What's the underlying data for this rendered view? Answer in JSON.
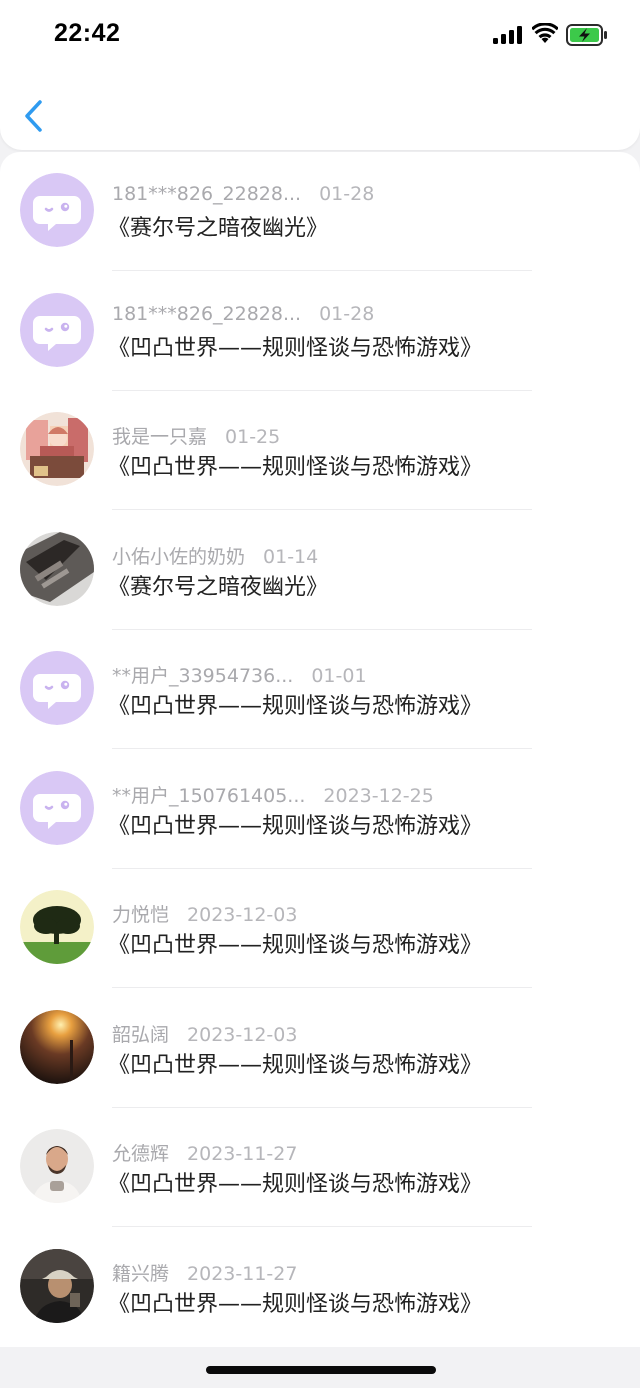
{
  "status_bar": {
    "time": "22:42",
    "icons": [
      "cellular-signal-icon",
      "wifi-icon",
      "battery-charging-icon"
    ],
    "battery_color": "#3cc94a"
  },
  "nav": {
    "back_icon": "chevron-left-icon",
    "accent_color": "#2f9bf0"
  },
  "list": {
    "items": [
      {
        "name": "181***826_22828...",
        "date": "01-28",
        "title": "《赛尔号之暗夜幽光》",
        "avatar": "default-chat-bubble-avatar"
      },
      {
        "name": "181***826_22828...",
        "date": "01-28",
        "title": "《凹凸世界——规则怪谈与恐怖游戏》",
        "avatar": "default-chat-bubble-avatar"
      },
      {
        "name": "我是一只嘉",
        "date": "01-25",
        "title": "《凹凸世界——规则怪谈与恐怖游戏》",
        "avatar": "anime-illustration-avatar"
      },
      {
        "name": "小佑小佐的奶奶",
        "date": "01-14",
        "title": "《赛尔号之暗夜幽光》",
        "avatar": "photo-avatar"
      },
      {
        "name": "**用户_33954736...",
        "date": "01-01",
        "title": "《凹凸世界——规则怪谈与恐怖游戏》",
        "avatar": "default-chat-bubble-avatar"
      },
      {
        "name": "**用户_150761405...",
        "date": "2023-12-25",
        "title": "《凹凸世界——规则怪谈与恐怖游戏》",
        "avatar": "default-chat-bubble-avatar"
      },
      {
        "name": "力悦恺",
        "date": "2023-12-03",
        "title": "《凹凸世界——规则怪谈与恐怖游戏》",
        "avatar": "tree-landscape-avatar"
      },
      {
        "name": "韶弘阔",
        "date": "2023-12-03",
        "title": "《凹凸世界——规则怪谈与恐怖游戏》",
        "avatar": "sunset-photo-avatar"
      },
      {
        "name": "允德辉",
        "date": "2023-11-27",
        "title": "《凹凸世界——规则怪谈与恐怖游戏》",
        "avatar": "person-photo-avatar"
      },
      {
        "name": "籍兴腾",
        "date": "2023-11-27",
        "title": "《凹凸世界——规则怪谈与恐怖游戏》",
        "avatar": "person-cap-photo-avatar"
      }
    ]
  },
  "colors": {
    "default_avatar_bg": "#d9c8f5",
    "meta_text": "#a9a9ad",
    "title_text": "#222222"
  }
}
